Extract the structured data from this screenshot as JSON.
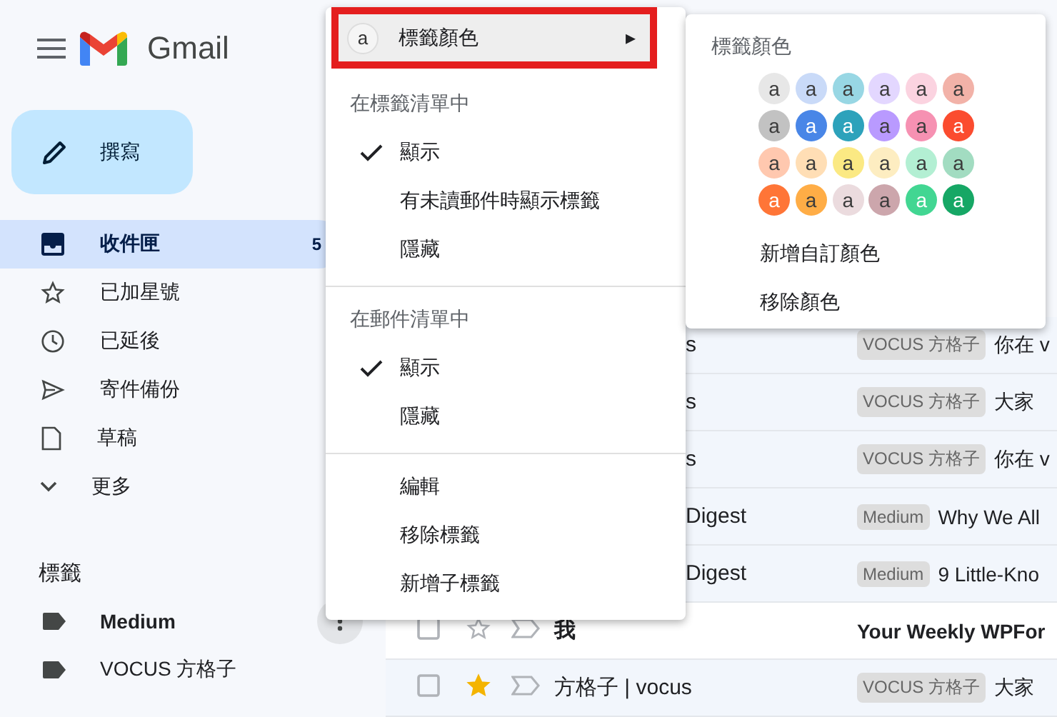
{
  "sidebar": {
    "brand": "Gmail",
    "compose": "撰寫",
    "nav": [
      {
        "kind": "inbox",
        "label": "收件匣",
        "selected": true,
        "count": "5"
      },
      {
        "kind": "star",
        "label": "已加星號",
        "selected": false
      },
      {
        "kind": "clock",
        "label": "已延後",
        "selected": false
      },
      {
        "kind": "send",
        "label": "寄件備份",
        "selected": false
      },
      {
        "kind": "draft",
        "label": "草稿",
        "selected": false
      },
      {
        "kind": "more",
        "label": "更多",
        "selected": false
      }
    ],
    "labels_heading": "標籤",
    "labels": [
      {
        "name": "Medium",
        "unread": true,
        "menu_open": true
      },
      {
        "name": "VOCUS 方格子",
        "unread": false,
        "menu_open": false
      }
    ]
  },
  "mail_rows": [
    {
      "sender": "s",
      "label": "VOCUS 方格子",
      "subject": "你在 v",
      "unread": false
    },
    {
      "sender": "s",
      "label": "VOCUS 方格子",
      "subject": "大家",
      "unread": false
    },
    {
      "sender": "s",
      "label": "VOCUS 方格子",
      "subject": "你在 v",
      "unread": false
    },
    {
      "sender": "Digest",
      "label": "Medium",
      "subject": "Why We All",
      "unread": false
    },
    {
      "sender": "Digest",
      "label": "Medium",
      "subject": "9 Little-Kno",
      "unread": false
    },
    {
      "sender": "我",
      "subject": "Your Weekly WPFor",
      "unread": true,
      "starred": false
    },
    {
      "sender": "方格子 | vocus",
      "label": "VOCUS 方格子",
      "subject": "大家",
      "unread": false,
      "starred": true
    }
  ],
  "label_menu": {
    "color_item": {
      "badge": "a",
      "label": "標籤顏色",
      "highlighted": true,
      "arrow": "▸"
    },
    "sections": [
      {
        "heading": "在標籤清單中",
        "items": [
          {
            "label": "顯示",
            "checked": true
          },
          {
            "label": "有未讀郵件時顯示標籤",
            "checked": false
          },
          {
            "label": "隱藏",
            "checked": false
          }
        ]
      },
      {
        "heading": "在郵件清單中",
        "items": [
          {
            "label": "顯示",
            "checked": true
          },
          {
            "label": "隱藏",
            "checked": false
          }
        ]
      },
      {
        "items": [
          {
            "label": "編輯",
            "checked": false
          },
          {
            "label": "移除標籤",
            "checked": false
          },
          {
            "label": "新增子標籤",
            "checked": false
          }
        ]
      }
    ]
  },
  "color_menu": {
    "title": "標籤顏色",
    "swatches": [
      {
        "label": "a",
        "color": "#e7e7e7"
      },
      {
        "label": "a",
        "color": "#c9daf8"
      },
      {
        "label": "a",
        "color": "#98d7e4"
      },
      {
        "label": "a",
        "color": "#e3d7ff"
      },
      {
        "label": "a",
        "color": "#fbd3e0"
      },
      {
        "label": "a",
        "color": "#f2b2a8"
      },
      {
        "label": "a",
        "color": "#c2c2c2"
      },
      {
        "label": "a",
        "color": "#4986e7"
      },
      {
        "label": "a",
        "color": "#2da2bb"
      },
      {
        "label": "a",
        "color": "#b99aff"
      },
      {
        "label": "a",
        "color": "#f691b2"
      },
      {
        "label": "a",
        "color": "#fb4c2f"
      },
      {
        "label": "a",
        "color": "#ffc8af"
      },
      {
        "label": "a",
        "color": "#ffdeb5"
      },
      {
        "label": "a",
        "color": "#fbe983"
      },
      {
        "label": "a",
        "color": "#fdedc1"
      },
      {
        "label": "a",
        "color": "#b3efd3"
      },
      {
        "label": "a",
        "color": "#a2dcc1"
      },
      {
        "label": "a",
        "color": "#ff7537"
      },
      {
        "label": "a",
        "color": "#ffad46"
      },
      {
        "label": "a",
        "color": "#ebdbde"
      },
      {
        "label": "a",
        "color": "#cca6ac"
      },
      {
        "label": "a",
        "color": "#42d692"
      },
      {
        "label": "a",
        "color": "#16a765"
      }
    ],
    "actions": [
      "新增自訂顏色",
      "移除顏色"
    ]
  }
}
